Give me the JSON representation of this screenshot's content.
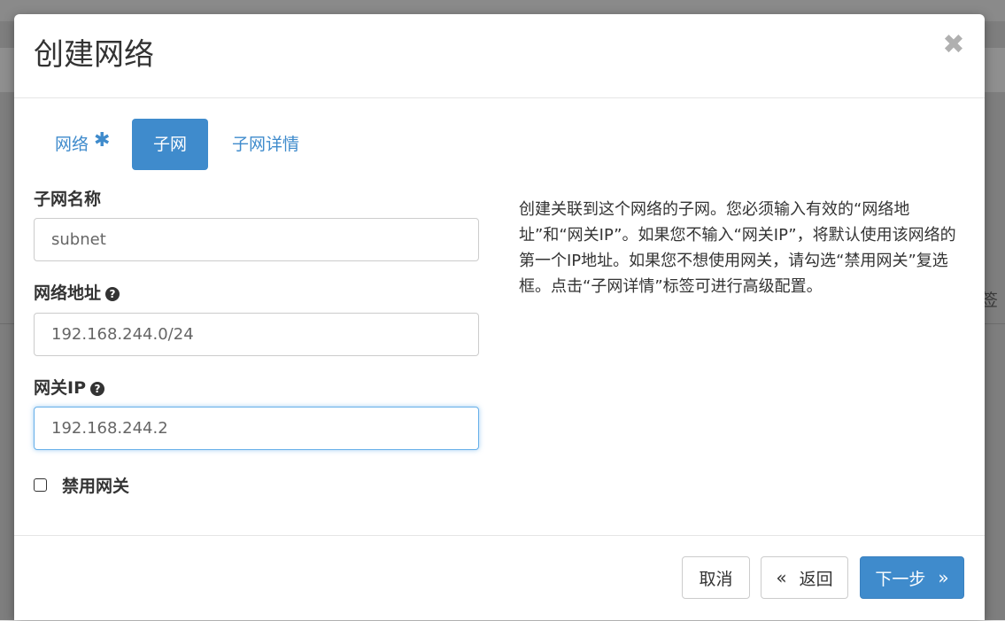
{
  "modal": {
    "title": "创建网络",
    "close_icon": "close-icon"
  },
  "tabs": [
    {
      "label": "网络",
      "required": true,
      "active": false
    },
    {
      "label": "子网",
      "active": true
    },
    {
      "label": "子网详情",
      "active": false
    }
  ],
  "required_marker": "✱",
  "form": {
    "subnet_name": {
      "label": "子网名称",
      "value": "",
      "placeholder": "subnet"
    },
    "network_address": {
      "label": "网络地址",
      "value": "",
      "placeholder": "192.168.244.0/24",
      "help_icon": "question-circle-icon"
    },
    "gateway_ip": {
      "label": "网关IP",
      "value": "",
      "placeholder": "192.168.244.2",
      "help_icon": "question-circle-icon",
      "focused": true
    },
    "disable_gateway": {
      "label": "禁用网关",
      "checked": false
    }
  },
  "help_text": "创建关联到这个网络的子网。您必须输入有效的“网络地址”和“网关IP”。如果您不输入“网关IP”，将默认使用该网络的第一个IP地址。如果您不想使用网关，请勾选“禁用网关”复选框。点击“子网详情”标签可进行高级配置。",
  "footer": {
    "cancel_label": "取消",
    "back_label": "返回",
    "next_label": "下一步",
    "back_icon": "«",
    "next_icon": "»"
  },
  "colors": {
    "primary": "#3f8bcc",
    "focus_border": "#66afe9"
  }
}
